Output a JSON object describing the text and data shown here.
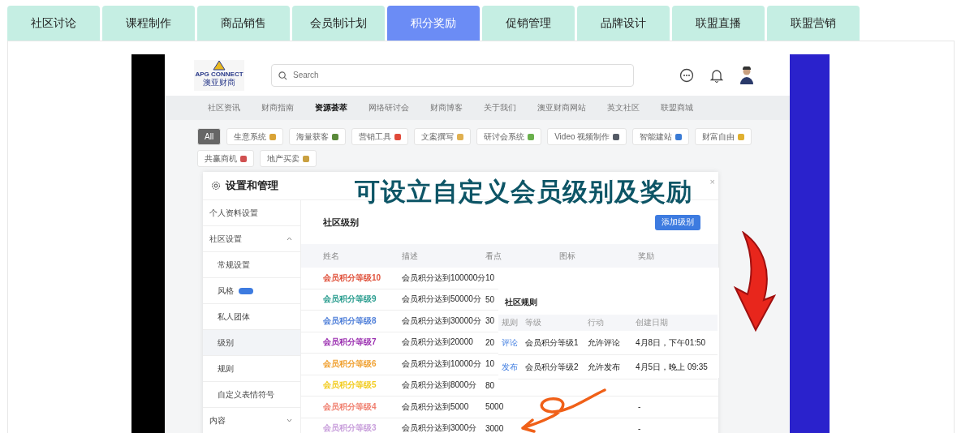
{
  "tabs": [
    {
      "label": "社区讨论",
      "selected": false
    },
    {
      "label": "课程制作",
      "selected": false
    },
    {
      "label": "商品销售",
      "selected": false
    },
    {
      "label": "会员制计划",
      "selected": false
    },
    {
      "label": "积分奖励",
      "selected": true
    },
    {
      "label": "促销管理",
      "selected": false
    },
    {
      "label": "品牌设计",
      "selected": false
    },
    {
      "label": "联盟直播",
      "selected": false
    },
    {
      "label": "联盟营销",
      "selected": false
    }
  ],
  "screenshot": {
    "logo": {
      "name": "APG CONNECT",
      "subtitle": "澳亚财商"
    },
    "search": {
      "placeholder": "Search"
    },
    "nav": [
      {
        "label": "社区资讯",
        "selected": false
      },
      {
        "label": "财商指南",
        "selected": false
      },
      {
        "label": "资源荟萃",
        "selected": true
      },
      {
        "label": "网络研讨会",
        "selected": false
      },
      {
        "label": "财商博客",
        "selected": false
      },
      {
        "label": "关于我们",
        "selected": false
      },
      {
        "label": "澳亚财商网站",
        "selected": false
      },
      {
        "label": "英文社区",
        "selected": false
      },
      {
        "label": "联盟商城",
        "selected": false
      }
    ],
    "chips": [
      {
        "label": "All",
        "selected": true
      },
      {
        "label": "生意系统",
        "selected": false,
        "color": "#d9a336"
      },
      {
        "label": "海量获客",
        "selected": false,
        "color": "#5a8a3a"
      },
      {
        "label": "营销工具",
        "selected": false,
        "color": "#e04a3a"
      },
      {
        "label": "文案撰写",
        "selected": false,
        "color": "#e0b050"
      },
      {
        "label": "研讨会系统",
        "selected": false,
        "color": "#6ab04c"
      },
      {
        "label": "Video 视频制作",
        "selected": false,
        "color": "#555b66"
      },
      {
        "label": "智能建站",
        "selected": false,
        "color": "#3a7bd5"
      },
      {
        "label": "财富自由",
        "selected": false,
        "color": "#e0b030"
      },
      {
        "label": "共赢商机",
        "selected": false,
        "color": "#d05050"
      },
      {
        "label": "地产买卖",
        "selected": false,
        "color": "#c9a040"
      }
    ],
    "settings": {
      "title": "设置和管理",
      "close": "×",
      "sidebar": [
        {
          "label": "个人资料设置",
          "selected": false
        },
        {
          "label": "社区设置",
          "selected": false,
          "expanded": true,
          "children": [
            {
              "label": "常规设置",
              "selected": false
            },
            {
              "label": "风格",
              "selected": false,
              "badge": true
            },
            {
              "label": "私人团体",
              "selected": false
            },
            {
              "label": "级别",
              "selected": true
            },
            {
              "label": "规则",
              "selected": false
            },
            {
              "label": "自定义表情符号",
              "selected": false
            }
          ]
        },
        {
          "label": "内容",
          "selected": false,
          "expanded": false
        }
      ],
      "heading": "社区级别",
      "add_button": "添加级别",
      "columns": [
        "姓名",
        "描述",
        "看点",
        "图标",
        "奖励"
      ],
      "rows": [
        {
          "name": "会员积分等级10",
          "color": "#e0533d",
          "description": "会员积分达到100000分",
          "points": "10"
        },
        {
          "name": "会员积分等级9",
          "color": "#2a9d8f",
          "description": "会员积分达到50000分",
          "points": "50"
        },
        {
          "name": "会员积分等级8",
          "color": "#4f7fd9",
          "description": "会员积分达到30000分",
          "points": "30"
        },
        {
          "name": "会员积分等级7",
          "color": "#9b30b0",
          "description": "会员积分达到20000",
          "points": "20"
        },
        {
          "name": "会员积分等级6",
          "color": "#f0a030",
          "description": "会员积分达到10000分",
          "points": "10"
        },
        {
          "name": "会员积分等级5",
          "color": "#f2cc20",
          "description": "会员积分达到8000分",
          "points": "80"
        },
        {
          "name": "会员积分等级4",
          "color": "#f08070",
          "description": "会员积分达到5000",
          "points": "5000",
          "reward": "-"
        },
        {
          "name": "会员积分等级3",
          "color": "#c9a0dc",
          "description": "会员积分达到3000分",
          "points": "3000",
          "reward": "-"
        }
      ],
      "rules": {
        "heading": "社区规则",
        "columns": [
          "规则",
          "等级",
          "行动",
          "创建日期"
        ],
        "rows": [
          {
            "rule": "评论",
            "level": "会员积分等级1",
            "action": "允许评论",
            "date": "4月8日，下午01:50"
          },
          {
            "rule": "发布",
            "level": "会员积分等级2",
            "action": "允许发布",
            "date": "4月5日，晚上 09:35"
          }
        ]
      }
    },
    "caption": "可设立自定义会员级别及奖励"
  }
}
